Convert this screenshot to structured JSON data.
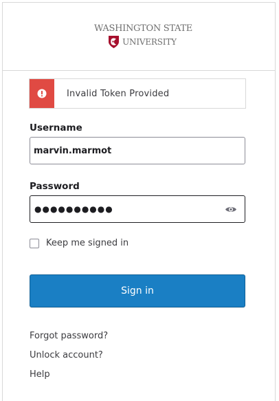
{
  "branding": {
    "logo_line1": "WASHINGTON STATE",
    "logo_line2": "UNIVERSITY",
    "shield_color": "#a60f2d"
  },
  "alert": {
    "icon": "exclamation-circle-icon",
    "color": "#e04a43",
    "message": "Invalid Token Provided"
  },
  "form": {
    "username_label": "Username",
    "username_value": "marvin.marmot",
    "password_label": "Password",
    "password_value": "●●●●●●●●●●",
    "show_password_icon": "eye-icon",
    "remember_label": "Keep me signed in",
    "remember_checked": false,
    "submit_label": "Sign in",
    "submit_color": "#1a7fc4"
  },
  "links": {
    "forgot": "Forgot password?",
    "unlock": "Unlock account?",
    "help": "Help"
  }
}
